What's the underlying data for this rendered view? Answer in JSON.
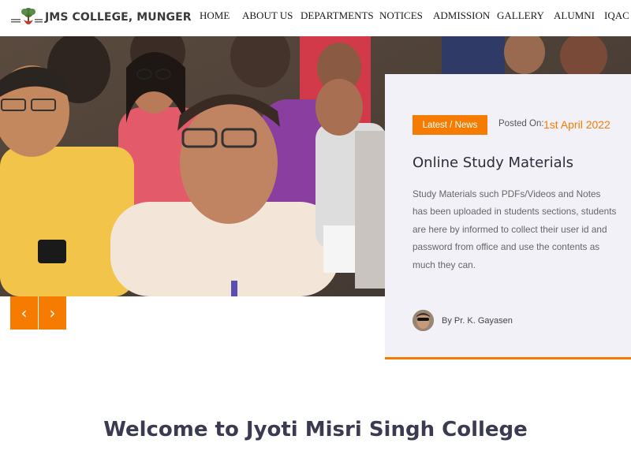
{
  "site": {
    "logo_text": "JMS COLLEGE, MUNGER"
  },
  "nav": {
    "items": [
      "HOME",
      "ABOUT US",
      "DEPARTMENTS",
      "NOTICES",
      "ADMISSION",
      "GALLERY",
      "ALUMNI",
      "IQAC"
    ]
  },
  "slider": {
    "prev_label": "‹",
    "next_label": "›"
  },
  "news_card": {
    "badge": "Latest / News",
    "posted_label": "Posted On:",
    "posted_date": "1st April 2022",
    "title": "Online Study Materials",
    "body": "Study Materials such PDFs/Videos and Notes has been uploaded in students sections, students are here by informed to collect their user id and password from office and use the contents as much they can.",
    "author": "By Pr. K. Gayasen"
  },
  "welcome": {
    "heading": "Welcome to Jyoti Misri Singh College"
  },
  "colors": {
    "accent": "#f57c00",
    "card_bg": "#f2f1f8",
    "heading": "#3a3a52"
  }
}
